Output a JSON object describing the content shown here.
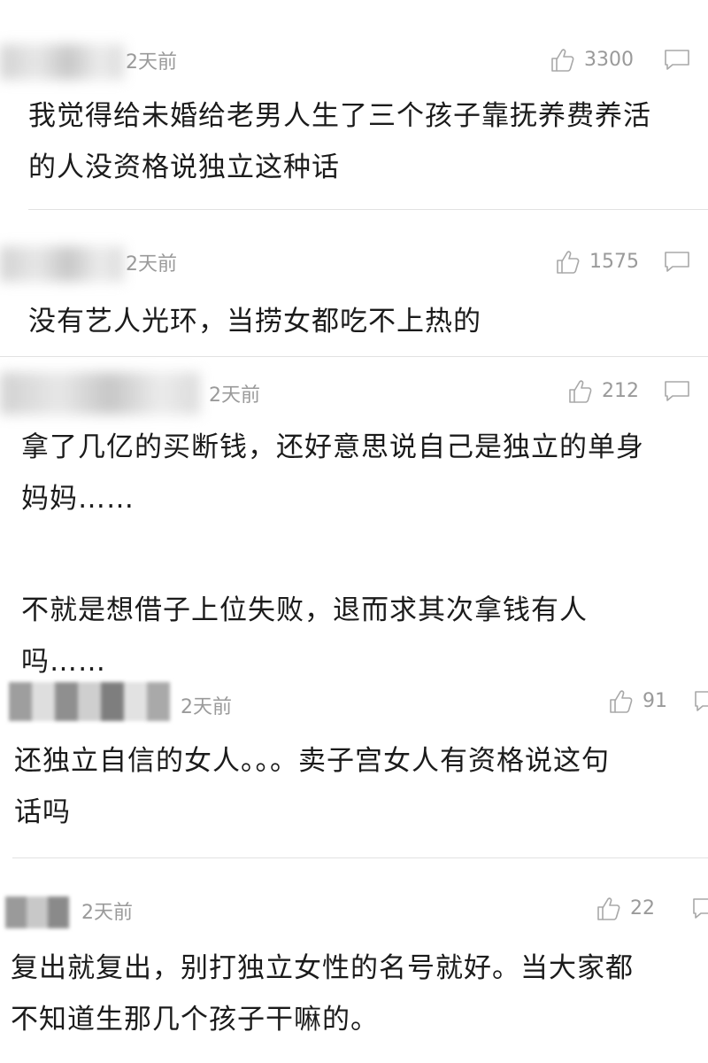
{
  "comments": [
    {
      "time": "2天前",
      "likes": "3300",
      "lines": [
        "我觉得给未婚给老男人生了三个孩子靠抚养费养活",
        "的人没资格说独立这种话"
      ]
    },
    {
      "time": "2天前",
      "likes": "1575",
      "lines": [
        "没有艺人光环，当捞女都吃不上热的"
      ]
    },
    {
      "time": "2天前",
      "likes": "212",
      "lines": [
        "拿了几亿的买断钱，还好意思说自己是独立的单身",
        "妈妈……",
        "",
        "不就是想借子上位失败，退而求其次拿钱有人",
        "吗……"
      ]
    },
    {
      "time": "2天前",
      "likes": "91",
      "lines": [
        "还独立自信的女人。。。卖子宫女人有资格说这句",
        "话吗"
      ]
    },
    {
      "time": "2天前",
      "likes": "22",
      "lines": [
        "复出就复出，别打独立女性的名号就好。当大家都",
        "不知道生那几个孩子干嘛的。"
      ]
    }
  ],
  "icons": {
    "like": "thumbs-up-icon",
    "reply": "comment-bubble-icon"
  },
  "colors": {
    "meta_gray": "#9a9a9a",
    "text": "#1b1b1b",
    "divider": "#e2e2e2"
  }
}
